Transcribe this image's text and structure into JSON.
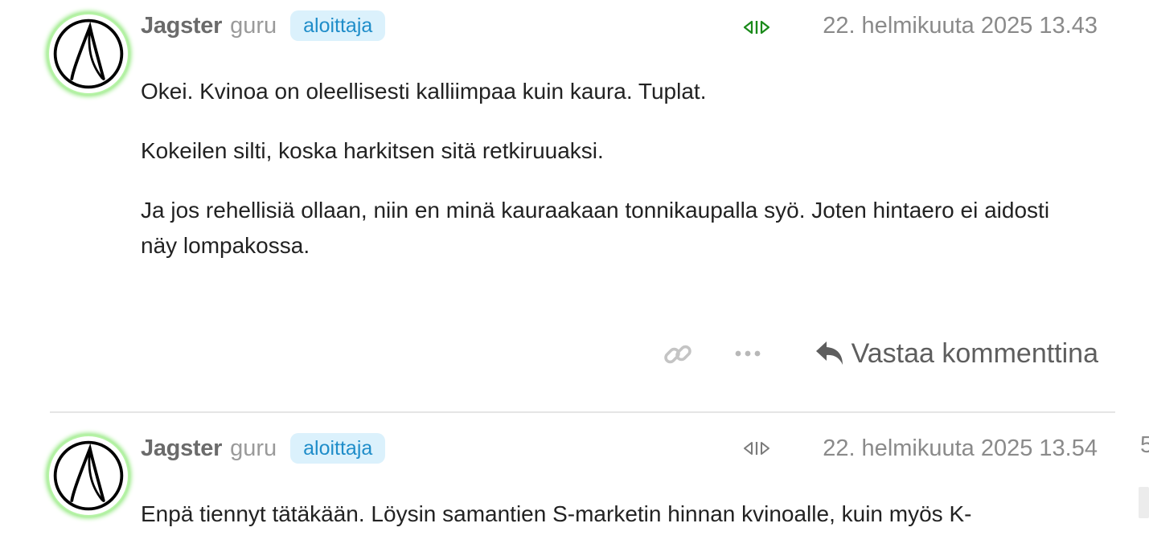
{
  "colors": {
    "avatar_glow": "#8fe87a",
    "badge_bg": "#dbf1fc",
    "badge_text": "#1f8dc9",
    "vote_active": "#1a8a1a",
    "vote_inactive": "#7a7a7a"
  },
  "posts": [
    {
      "username": "Jagster",
      "rank": "guru",
      "badge": "aloittaja",
      "vote_icon": "vote-arrows-icon",
      "vote_state": "active",
      "date": "22. helmikuuta 2025 13.43",
      "paragraphs": [
        "Okei. Kvinoa on oleellisesti kalliimpaa kuin kaura. Tuplat.",
        "Kokeilen silti, koska harkitsen sitä retkiruuaksi.",
        "Ja jos rehellisiä ollaan, niin en minä kauraakaan tonnikaupalla syö. Joten hintaero ei aidosti näy lompakossa."
      ],
      "actions": {
        "link_icon": "link-icon",
        "more_icon": "more-horizontal-icon",
        "reply_icon": "reply-arrow-icon",
        "reply_label": "Vastaa kommenttina"
      }
    },
    {
      "username": "Jagster",
      "rank": "guru",
      "badge": "aloittaja",
      "vote_icon": "vote-arrows-icon",
      "vote_state": "inactive",
      "date": "22. helmikuuta 2025 13.54",
      "paragraphs": [
        "Enpä tiennyt tätäkään. Löysin samantien S-marketin hinnan kvinoalle, kuin myös K-"
      ]
    }
  ],
  "edge_text": "5"
}
